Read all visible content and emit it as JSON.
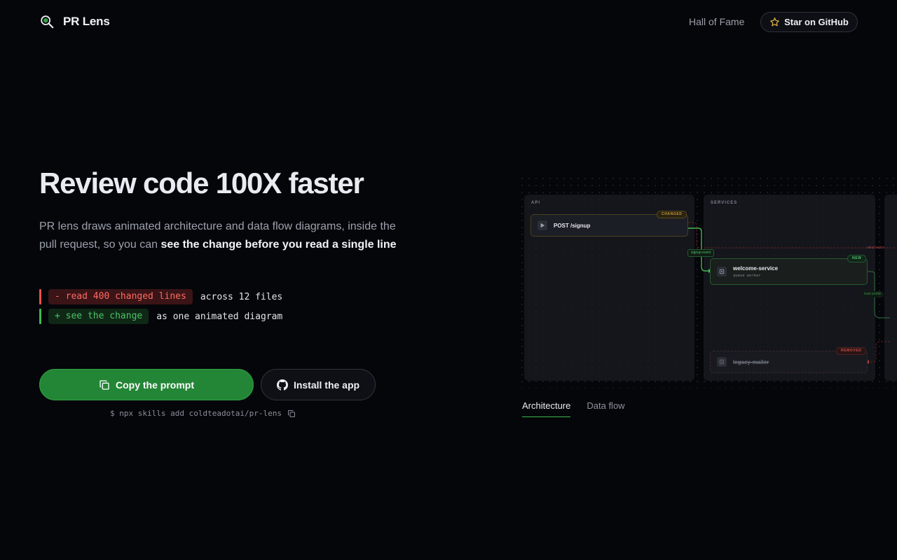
{
  "header": {
    "brand_name": "PR Lens",
    "nav_link": "Hall of Fame",
    "github_button": "Star on GitHub"
  },
  "hero": {
    "title": "Review code 100X faster",
    "description_plain": "PR lens draws animated architecture and data flow diagrams, inside the pull request, so you can ",
    "description_bold": "see the change before you read a single line",
    "diff": [
      {
        "chip": "- read 400 changed lines",
        "tail": "across 12 files",
        "type": "removed"
      },
      {
        "chip": "+ see the change",
        "tail": "as one animated diagram",
        "type": "added"
      }
    ],
    "copy_button": "Copy the prompt",
    "install_button": "Install the app",
    "npx_command": "$ npx skills add coldteadotai/pr-lens"
  },
  "diagram": {
    "groups": {
      "api": "API",
      "services": "SERVICES"
    },
    "nodes": {
      "post": {
        "title": "POST /signup",
        "badge": "CHANGED"
      },
      "welcome": {
        "title": "welcome-service",
        "subtitle": "queue worker",
        "badge": "NEW"
      },
      "legacy": {
        "title": "legacy-mailer",
        "badge": "REMOVED"
      }
    },
    "edge_labels": {
      "signup": "signup event",
      "send_welcome": "send welco",
      "load_profile": "load profile"
    }
  },
  "tabs": [
    {
      "label": "Architecture",
      "active": true
    },
    {
      "label": "Data flow",
      "active": false
    }
  ],
  "colors": {
    "background": "#05060a",
    "accent_green": "#238636",
    "removed_red": "#e5534b",
    "added_green": "#3fb950",
    "changed_amber": "#c99a3a"
  }
}
